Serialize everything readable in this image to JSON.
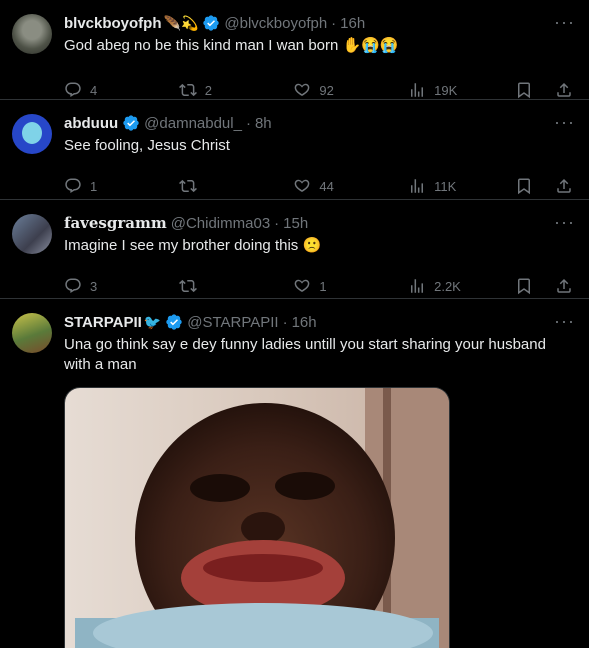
{
  "tweets": [
    {
      "name": "blvckboyofph",
      "name_emojis": "🪶💫",
      "handle": "@blvckboyofph",
      "time": "16h",
      "text": "God abeg no be this kind man I wan born ✋😭😭",
      "replies": "4",
      "retweets": "2",
      "likes": "92",
      "views": "19K"
    },
    {
      "name": "abduuu",
      "handle": "@damnabdul_",
      "time": "8h",
      "text": "See fooling, Jesus Christ",
      "replies": "1",
      "retweets": "",
      "likes": "44",
      "views": "11K"
    },
    {
      "name": "favesgramm",
      "handle": "@Chidimma03",
      "time": "15h",
      "text": "Imagine I see my brother doing this 🙁",
      "replies": "3",
      "retweets": "",
      "likes": "1",
      "views": "2.2K"
    },
    {
      "name": "STARPAPII",
      "name_emojis": "🐦",
      "handle": "@STARPAPII",
      "time": "16h",
      "text": "Una go think say e dey funny ladies untill you start sharing your husband with a man"
    }
  ],
  "colors": {
    "accent": "#1d9bf0",
    "muted": "#71767b",
    "text": "#e7e9ea",
    "bg": "#000000"
  },
  "icons": [
    "reply-icon",
    "retweet-icon",
    "like-icon",
    "views-icon",
    "bookmark-icon",
    "share-icon",
    "more-icon",
    "verified-badge-icon"
  ]
}
